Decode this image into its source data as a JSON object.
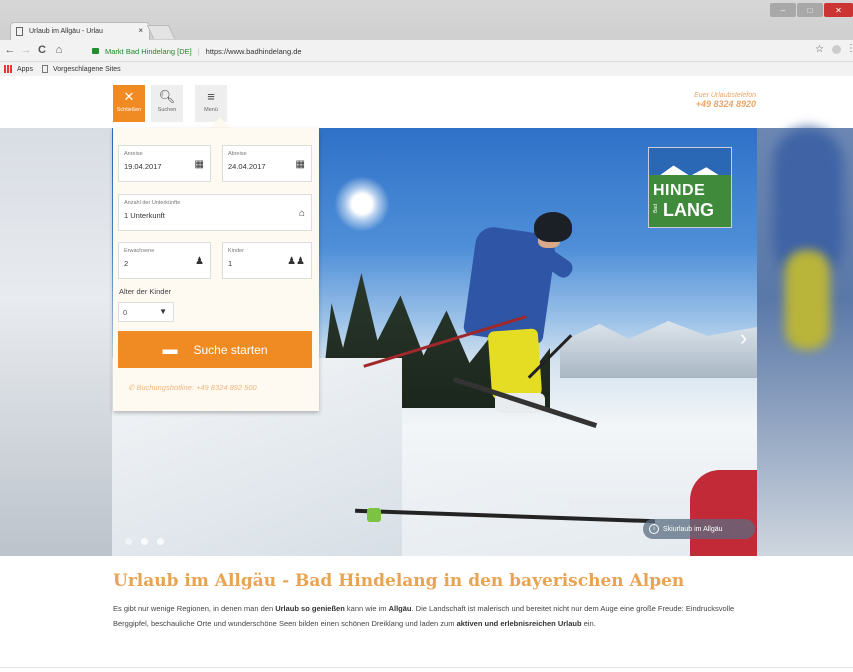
{
  "browser": {
    "tab_title": "Urlaub im Allgäu - Urlau",
    "tab_close": "×",
    "site_identity": "Markt Bad Hindelang [DE]",
    "url": "https://www.badhindelang.de",
    "bookmarks": [
      "Apps",
      "Vorgeschlagene Sites"
    ],
    "nav_icons": {
      "back": "←",
      "forward": "→",
      "reload": "C",
      "home": "⌂",
      "star": "☆",
      "menu": "⋮"
    }
  },
  "header": {
    "buttons": [
      {
        "icon": "close-icon",
        "glyph": "✕",
        "label": "Schließen"
      },
      {
        "icon": "search-icon",
        "glyph": "🔍︎",
        "label": "Suchen"
      },
      {
        "icon": "menu-icon",
        "glyph": "≡",
        "label": "Menü"
      }
    ],
    "hotline_label": "Euer Urlaubstelefon",
    "hotline_number": "+49 8324 8920"
  },
  "logo": {
    "line1": "HINDE",
    "line2": "LANG",
    "side": "Bad"
  },
  "booking": {
    "arrival": {
      "label": "Anreise",
      "value": "19.04.2017"
    },
    "departure": {
      "label": "Abreise",
      "value": "24.04.2017"
    },
    "units": {
      "label": "Anzahl der Unterkünfte",
      "value": "1 Unterkunft"
    },
    "adults": {
      "label": "Erwachsene",
      "value": "2"
    },
    "children": {
      "label": "Kinder",
      "value": "1"
    },
    "ages_label": "Alter der Kinder",
    "age_value": "0",
    "search_label": "Suche starten",
    "hotline": "Buchungshotline: +49 8324 892 500"
  },
  "hero": {
    "caption": "Skiurlaub im Allgäu",
    "slide_count": 3,
    "active_slide": 1
  },
  "article": {
    "title": "Urlaub im Allgäu - Bad Hindelang in den bayerischen Alpen",
    "p1_a": "Es gibt nur wenige Regionen, in denen man den ",
    "p1_b": "Urlaub so genießen",
    "p1_c": " kann wie im ",
    "p1_d": "Allgäu",
    "p1_e": ". Die Landschaft ist malerisch und bereitet nicht nur dem Auge eine große Freude: Eindrucksvolle Berggipfel, beschauliche Orte und wunderschöne Seen bilden einen schönen Dreiklang und laden zum ",
    "p1_f": "aktiven und erlebnisreichen Urlaub",
    "p1_g": " ein."
  },
  "colors": {
    "accent": "#f08b24",
    "title": "#e8a353",
    "panel": "#fffaf1"
  }
}
